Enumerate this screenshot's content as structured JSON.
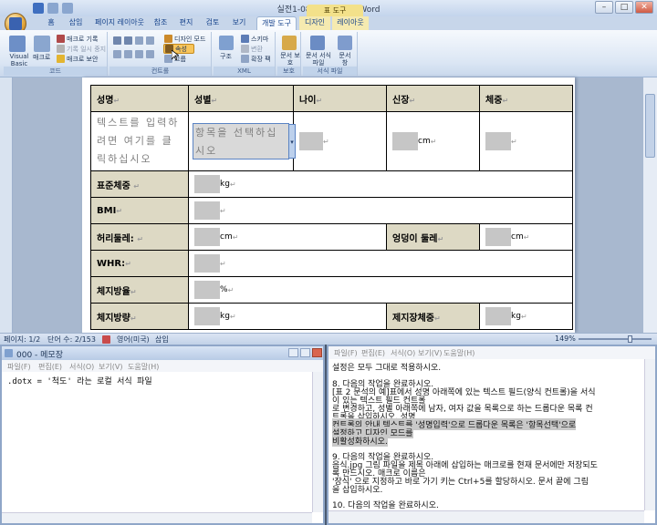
{
  "word": {
    "title": "실전1-08 - Microsoft Word",
    "context_tab": "표 도구",
    "tabs": [
      "홈",
      "삽입",
      "페이지 레이아웃",
      "참조",
      "편지",
      "검토",
      "보기",
      "개발 도구",
      "디자인",
      "레이아웃"
    ],
    "active_tab": "개발 도구",
    "ribbon": {
      "code": {
        "label": "코드",
        "visual_basic": "Visual Basic",
        "macro": "매크로",
        "record": "매크로 기록",
        "pause": "기록 일시 중지",
        "security": "매크로 보안"
      },
      "controls": {
        "label": "컨트롤",
        "design_mode": "디자인 모드",
        "properties": "속성",
        "group": "그룹"
      },
      "xml": {
        "label": "XML",
        "structure": "구조",
        "schema": "스키마",
        "transform": "변환",
        "expansion": "확장 팩"
      },
      "protect": {
        "label": "보호",
        "protect_doc": "문서 보호"
      },
      "templates": {
        "label": "서식 파일",
        "doc_template": "문서 서식 파일",
        "doc_panel": "문서 창"
      }
    },
    "table": {
      "headers": [
        "성명",
        "성별",
        "나이",
        "신장",
        "체중"
      ],
      "placeholder_text": "텍스트를 입력하려면 여기를 클릭하십시오",
      "dropdown_text": "항목을 선택하십시오",
      "rows": {
        "std_weight": "표준체중",
        "bmi": "BMI",
        "waist": "허리둘레:",
        "hip": "엉덩이 둘레",
        "whr": "WHR:",
        "fat_rate": "체지방율",
        "fat_amount": "체지방량",
        "lean_weight": "제지장체중"
      },
      "units": {
        "kg": "kg",
        "cm": "cm",
        "percent": "%"
      }
    },
    "status": {
      "page": "페이지: 1/2",
      "words": "단어 수: 2/153",
      "language": "영어(미국)",
      "mode": "삽입",
      "zoom": "149%"
    }
  },
  "notepad": {
    "title": "000 - 메모장",
    "menu": [
      "파일(F)",
      "편집(E)",
      "서식(O)",
      "보기(V)",
      "도움말(H)"
    ],
    "content": ".dotx = '척도' 라는 로컬 서식 파일"
  },
  "instructions": {
    "menu": [
      "파일(F)",
      "편집(E)",
      "서식(O)",
      "보기(V)",
      "도움말(H)"
    ],
    "lines": [
      "설정은 모두 그대로 적용하시오.",
      "",
      "8. 다음의 작업을 완료하시오.",
      "  [표 2 문석의 예]표에서 성명 아래쪽에 있는 텍스트 필드(양식 컨트롤)을 서식",
      "이 있는 텍스트 필드 컨트롤",
      "로 변경하고, 성별 아래쪽에 남자, 여자 값을 목록으로 하는 드롭다운 목록 컨",
      "트롤을 삽입하시오. 성명",
      "  컨트롤의 안내 텍스트를 '성명입력'으로 드롭다운 목록은 '항목선택'으로",
      "설정하고 디자인 모드를",
      "  비활성화하시오.",
      "",
      "9. 다음의 작업을 완료하시오.",
      "  음식.jpg 그림 파일을 제목 아래에 삽입하는 매크로를 현재 문서에만 저장되도",
      "록 만드시오. 매크로 이름은",
      "  '장식' 으로 지정하고 바로 가기 키는 Ctrl+5를 할당하시오. 문서 끝에 그림",
      "을 삽입하시오.",
      "",
      "10. 다음의 작업을 완료하시오."
    ]
  },
  "colors": {
    "header_fill": "#ddd9c4",
    "content_control": "#c6c6c6",
    "ribbon_blue": "#c7d6ea"
  }
}
